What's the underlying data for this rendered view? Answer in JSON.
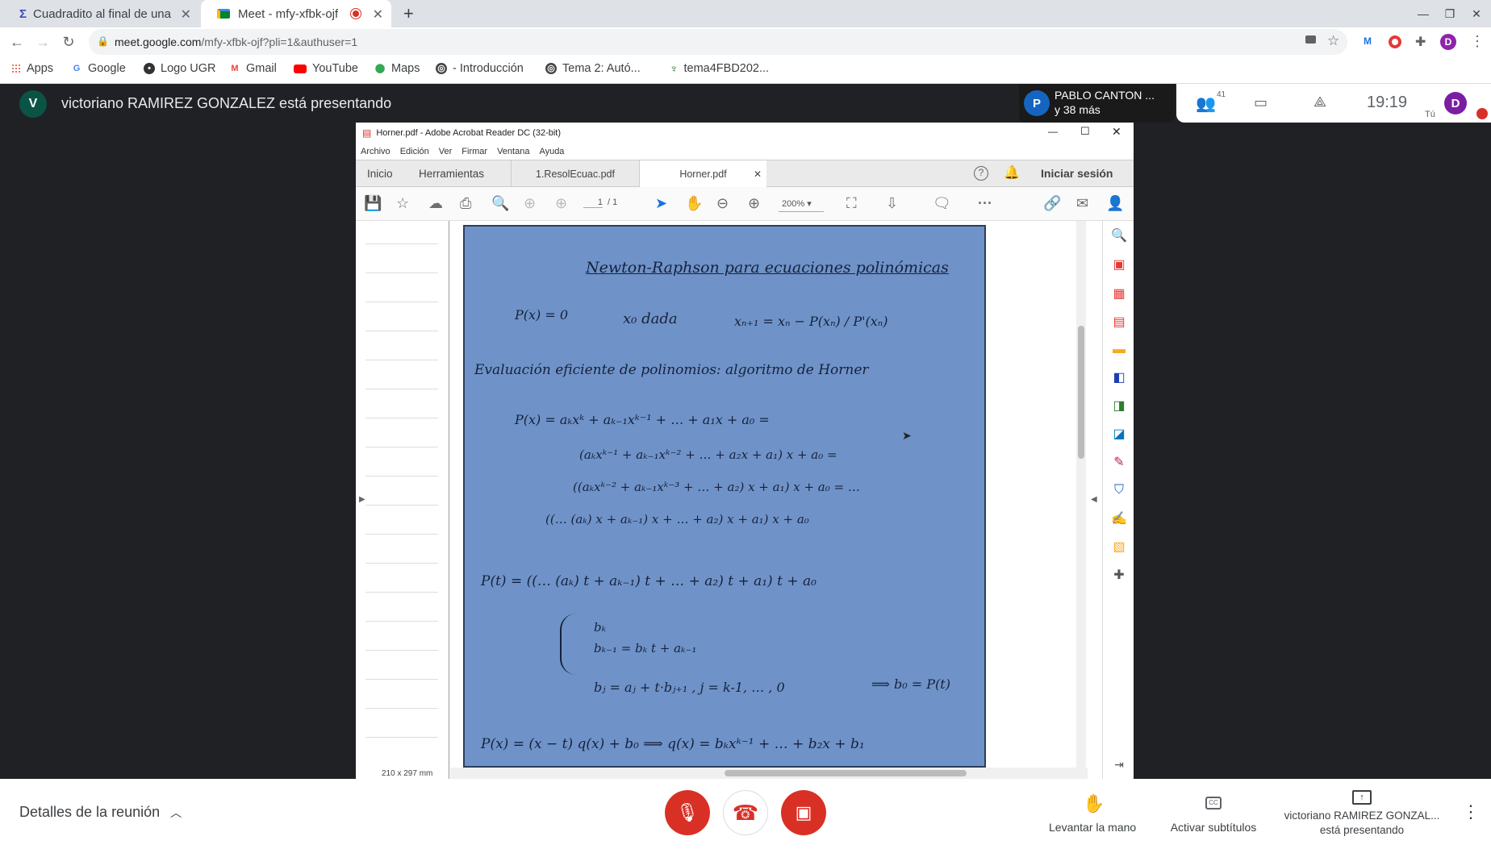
{
  "browser": {
    "tabs": [
      {
        "label": "Cuadradito al final de una",
        "icon": "sigma-icon"
      },
      {
        "label": "Meet - mfy-xfbk-ojf",
        "icon": "meet-icon",
        "recording": true
      }
    ],
    "url_domain": "meet.google.com",
    "url_path": "/mfy-xfbk-ojf?pli=1&authuser=1",
    "profile_initial": "D",
    "bookmarks": [
      "Apps",
      "Google",
      "Logo UGR",
      "Gmail",
      "YouTube",
      "Maps",
      "- Introducción",
      "Tema 2: Autó...",
      "tema4FBD202..."
    ]
  },
  "meet": {
    "presenter_initial": "V",
    "presenter_text": "victoriano RAMIREZ GONZALEZ está presentando",
    "participant_initial": "P",
    "participant_name": "PABLO CANTON ...",
    "participant_more": "y 38 más",
    "participants_count": "41",
    "clock": "19:19",
    "self_label": "Tú",
    "self_initial": "D",
    "meeting_details": "Detalles de la reunión",
    "raise_hand": "Levantar la mano",
    "captions": "Activar subtítulos",
    "presenting_line1": "victoriano RAMIREZ GONZAL...",
    "presenting_line2": "está presentando"
  },
  "acrobat": {
    "title": "Horner.pdf - Adobe Acrobat Reader DC (32-bit)",
    "menu": [
      "Archivo",
      "Edición",
      "Ver",
      "Firmar",
      "Ventana",
      "Ayuda"
    ],
    "tabs": [
      "Inicio",
      "Herramientas",
      "1.ResolEcuac.pdf",
      "Horner.pdf"
    ],
    "signin": "Iniciar sesión",
    "page_current": "1",
    "page_total": "/ 1",
    "zoom": "200%",
    "page_size": "210 x 297 mm",
    "notes": {
      "title": "Newton-Raphson para ecuaciones polinómicas",
      "l1a": "P(x) = 0",
      "l1b": "x₀ dada",
      "l1c": "xₙ₊₁ = xₙ − P(xₙ) / P'(xₙ)",
      "l2": "Evaluación eficiente de polinomios: algoritmo de Horner",
      "l3": "P(x) = aₖxᵏ + aₖ₋₁xᵏ⁻¹ + … + a₁x + a₀ =",
      "l4": "(aₖxᵏ⁻¹ + aₖ₋₁xᵏ⁻² + … + a₂x + a₁) x + a₀ =",
      "l5": "((aₖxᵏ⁻² + aₖ₋₁xᵏ⁻³ + … + a₂) x + a₁) x + a₀ = …",
      "l6": "((… (aₖ) x + aₖ₋₁) x + … + a₂) x + a₁) x + a₀",
      "l7": "P(t) = ((… (aₖ) t + aₖ₋₁) t + … + a₂) t + a₁) t + a₀",
      "l8": "bₖ",
      "l9": "bₖ₋₁ = bₖ t + aₖ₋₁",
      "l10": "bⱼ = aⱼ + t·bⱼ₊₁ ,  j = k-1, … , 0",
      "l10b": "⟹ b₀ = P(t)",
      "l11": "P(x) = (x − t) q(x) + b₀   ⟹  q(x) = bₖxᵏ⁻¹ + … + b₂x + b₁"
    }
  }
}
